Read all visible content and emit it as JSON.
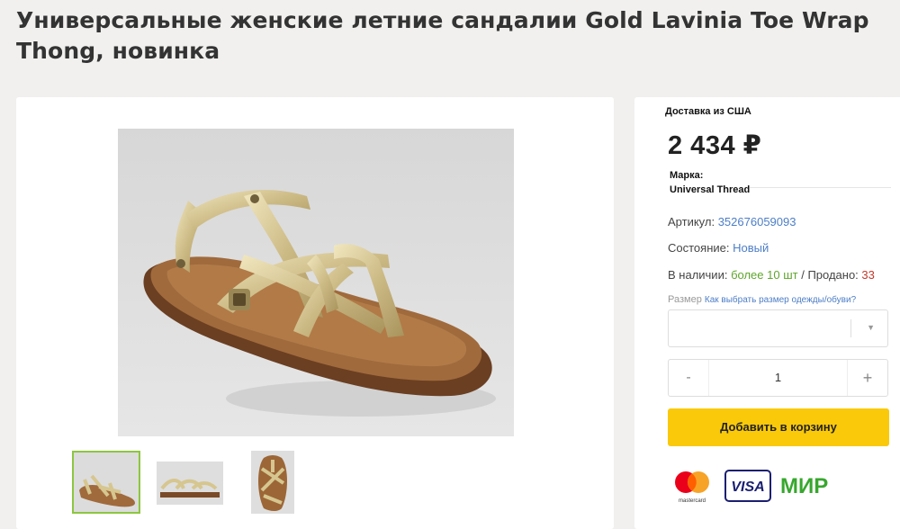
{
  "product": {
    "title": "Универсальные женские летние сандалии Gold Lavinia Toe Wrap Thong, новинка"
  },
  "gallery": {
    "images": [
      {
        "name": "main-product-photo",
        "semantic": "sandal-photo"
      },
      {
        "name": "thumbnail-1",
        "semantic": "sandal-side-photo"
      },
      {
        "name": "thumbnail-2",
        "semantic": "sandal-side-flat-photo"
      },
      {
        "name": "thumbnail-3",
        "semantic": "sandal-top-photo"
      }
    ],
    "active_thumbnail": 1
  },
  "purchase": {
    "delivery": "Доставка из США",
    "price": "2 434 ₽",
    "brand_label": "Марка:",
    "brand_value": "Universal Thread",
    "article_label": "Артикул:",
    "article_value": "352676059093",
    "condition_label": "Состояние:",
    "condition_value": "Новый",
    "stock_label": "В наличии:",
    "stock_value": "более 10 шт",
    "sold_label": "/ Продано:",
    "sold_value": "33",
    "size_label": "Размер",
    "size_help_link": "Как выбрать размер одежды/обуви?",
    "size_selected": "",
    "quantity_minus": "-",
    "quantity_value": "1",
    "quantity_plus": "+",
    "add_to_cart": "Добавить в корзину"
  },
  "payment": {
    "mastercard_text": "mastercard",
    "visa_text": "VISA",
    "mir_text": "МИР"
  },
  "colors": {
    "background": "#f1f0ee",
    "link": "#4d7ec7",
    "in_stock": "#5fa62b",
    "sold": "#c0392b",
    "cart_button": "#f9c90a",
    "active_thumb_border": "#8dc63f",
    "visa_blue": "#1a1f71",
    "mir_green": "#37a72e"
  }
}
